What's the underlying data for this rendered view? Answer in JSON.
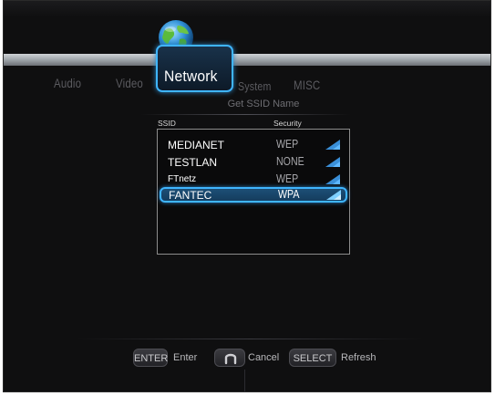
{
  "tabs": [
    {
      "label": "Audio"
    },
    {
      "label": "Video"
    },
    {
      "label": "Network"
    },
    {
      "label": "System"
    },
    {
      "label": "MISC"
    }
  ],
  "active_tab": "Network",
  "subtitle": "Get SSID Name",
  "columns": {
    "ssid": "SSID",
    "security": "Security"
  },
  "networks": [
    {
      "ssid": "MEDIANET",
      "security": "WEP"
    },
    {
      "ssid": "TESTLAN",
      "security": "NONE"
    },
    {
      "ssid": "FTnetz",
      "security": "WEP"
    },
    {
      "ssid": "FANTEC",
      "security": "WPA",
      "selected": true
    }
  ],
  "footer": {
    "enter_key": "ENTER",
    "enter_label": "Enter",
    "back_key_icon": "return-icon",
    "cancel_label": "Cancel",
    "select_key": "SELECT",
    "refresh_label": "Refresh"
  },
  "colors": {
    "accent": "#3fb5ff",
    "background": "#0f0f10",
    "selected_row": "#1d4f76"
  }
}
